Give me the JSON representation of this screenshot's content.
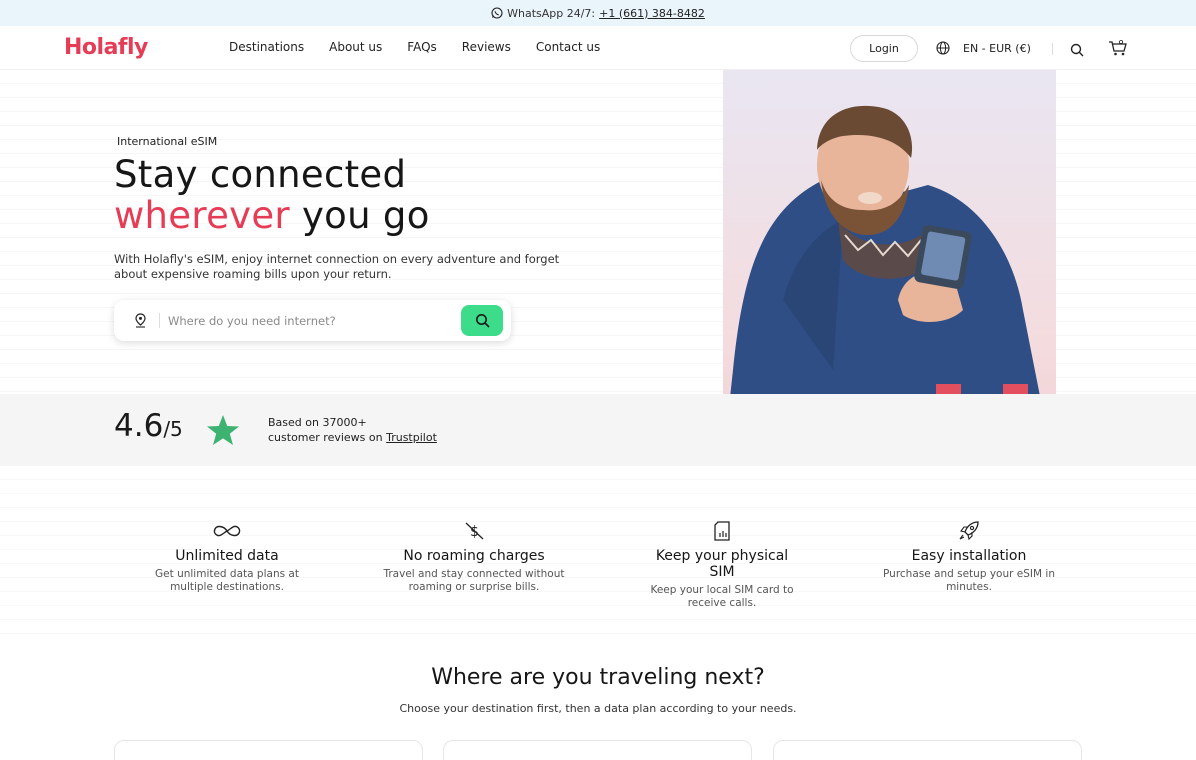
{
  "topbar": {
    "label": "WhatsApp 24/7:",
    "phone": "+1 (661) 384-8482",
    "icon": "whatsapp-icon"
  },
  "header": {
    "logo": "Holafly",
    "nav": [
      {
        "label": "Destinations"
      },
      {
        "label": "About us"
      },
      {
        "label": "FAQs"
      },
      {
        "label": "Reviews"
      },
      {
        "label": "Contact us"
      }
    ],
    "login_label": "Login",
    "language": "EN - EUR (€)",
    "icons": [
      "globe-icon",
      "search-icon",
      "cart-icon"
    ],
    "accent_color": "#e63c55"
  },
  "hero": {
    "eyebrow": "International eSIM",
    "title_line1": "Stay connected",
    "title_accent": "wherever",
    "title_rest": " you go",
    "lead": "With Holafly's eSIM, enjoy internet connection on every adventure and forget about expensive roaming bills upon your return.",
    "search_placeholder": "Where do you need internet?",
    "search_button_color": "#3ddc8b"
  },
  "rating": {
    "score": "4.6",
    "out_of": "/5",
    "line1": "Based on 37000+",
    "line2": "customer reviews on ",
    "trustpilot": "Trustpilot",
    "star_color": "#3cb371"
  },
  "features": [
    {
      "icon": "infinity-icon",
      "title": "Unlimited data",
      "desc": "Get unlimited data plans at multiple destinations."
    },
    {
      "icon": "no-dollar-icon",
      "title": "No roaming charges",
      "desc": "Travel and stay connected without roaming or surprise bills."
    },
    {
      "icon": "sim-card-icon",
      "title": "Keep your physical SIM",
      "desc": "Keep your local SIM card to receive calls."
    },
    {
      "icon": "rocket-icon",
      "title": "Easy installation",
      "desc": "Purchase and setup your eSIM in minutes."
    }
  ],
  "destinations": {
    "title": "Where are you traveling next?",
    "subtitle": "Choose your destination first, then a data plan according to your needs."
  }
}
